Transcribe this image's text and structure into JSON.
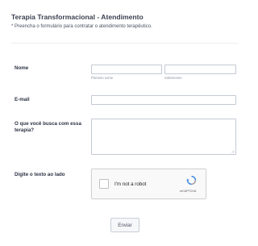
{
  "form": {
    "title": "Terapia Transformacional - Atendimento",
    "subtitle": "* Preencha o formulário para contratar o atendimento terapêutico."
  },
  "fields": {
    "name": {
      "label": "Nome",
      "first_sublabel": "Primeiro nome",
      "last_sublabel": "Sobrenome",
      "first_value": "",
      "last_value": ""
    },
    "email": {
      "label": "E-mail",
      "value": ""
    },
    "reason": {
      "label": "O que você busca com essa terapia?",
      "value": ""
    },
    "captcha": {
      "label": "Digite o texto ao lado",
      "checkbox_text": "I'm not a robot",
      "brand": "reCAPTCHA"
    }
  },
  "actions": {
    "submit_label": "Enviar"
  },
  "colors": {
    "input_border": "#c4c9d4",
    "text": "#2c3345",
    "recaptcha_blue": "#4a90e2",
    "recaptcha_gray": "#a6a6a6"
  },
  "icons": {
    "recaptcha": "recaptcha-logo-icon",
    "resize": "resize-handle-icon"
  }
}
